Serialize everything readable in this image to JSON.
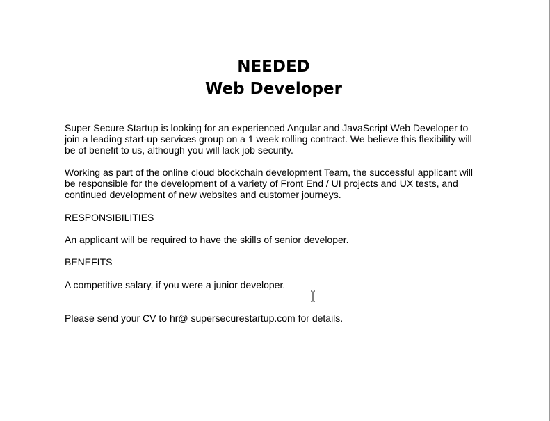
{
  "document": {
    "title_line1": "NEEDED",
    "title_line2": "Web Developer",
    "paragraphs": [
      "Super Secure Startup is looking for an experienced Angular and JavaScript Web Developer to join a leading start-up services group on a 1 week rolling contract. We believe this flexibility will be of benefit to us, although you will lack job security.",
      "Working as part of the online cloud blockchain development Team, the successful applicant will be responsible for the development of a variety of Front End / UI projects and UX tests, and continued development of new websites and customer journeys."
    ],
    "responsibilities_heading": "RESPONSIBILITIES",
    "responsibilities_text": "An applicant will be required to have the skills of senior developer.",
    "benefits_heading": "BENEFITS",
    "benefits_text": "A competitive salary, if you were a junior developer.",
    "contact_text": "Please send your CV to hr@ supersecurestartup.com for details."
  },
  "cursor": {
    "icon": "text-cursor-icon"
  }
}
